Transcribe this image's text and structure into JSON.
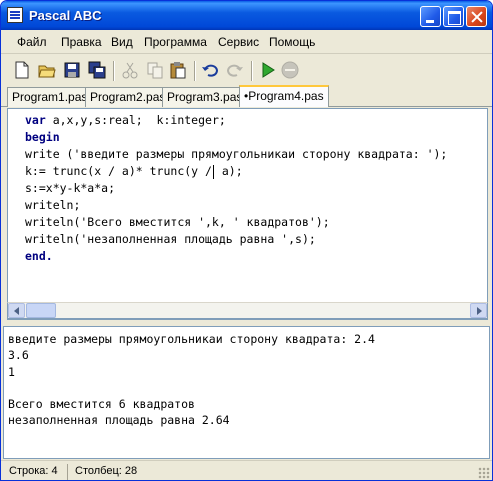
{
  "window": {
    "title": "Pascal ABC"
  },
  "menu": [
    "Файл",
    "Правка",
    "Вид",
    "Программа",
    "Сервис",
    "Помощь"
  ],
  "toolbar": {
    "tools": [
      "new-file",
      "open-folder",
      "save",
      "save-all",
      "cut",
      "copy",
      "paste",
      "undo",
      "redo",
      "run",
      "stop"
    ]
  },
  "tabs": [
    "Program1.pas",
    "Program2.pas",
    "Program3.pas",
    "•Program4.pas"
  ],
  "editor": {
    "lines": [
      [
        "var",
        " a,x,y,s:real;  k:integer;"
      ],
      [
        "begin",
        ""
      ],
      [
        "",
        "write ('введите размеры прямоугольникаи сторону квадрата: ');"
      ],
      [
        "",
        "k:= trunc(x / a)* trunc(y /"
      ],
      [
        "",
        "s:=x*y-k*a*a;"
      ],
      [
        "",
        "writeln;"
      ],
      [
        "",
        "writeln('Всего вместится ',k, ' квадратов');"
      ],
      [
        "",
        "writeln('незаполненная площадь равна ',s);"
      ],
      [
        "end.",
        ""
      ]
    ],
    "line4_tail": " a);"
  },
  "output": {
    "lines": [
      "введите размеры прямоугольникаи сторону квадрата: 2.4",
      "3.6",
      "1",
      "",
      "Всего вместится 6 квадратов",
      "незаполненная площадь равна 2.64"
    ]
  },
  "status": {
    "line": "Строка: 4",
    "column": "Столбец: 28"
  }
}
